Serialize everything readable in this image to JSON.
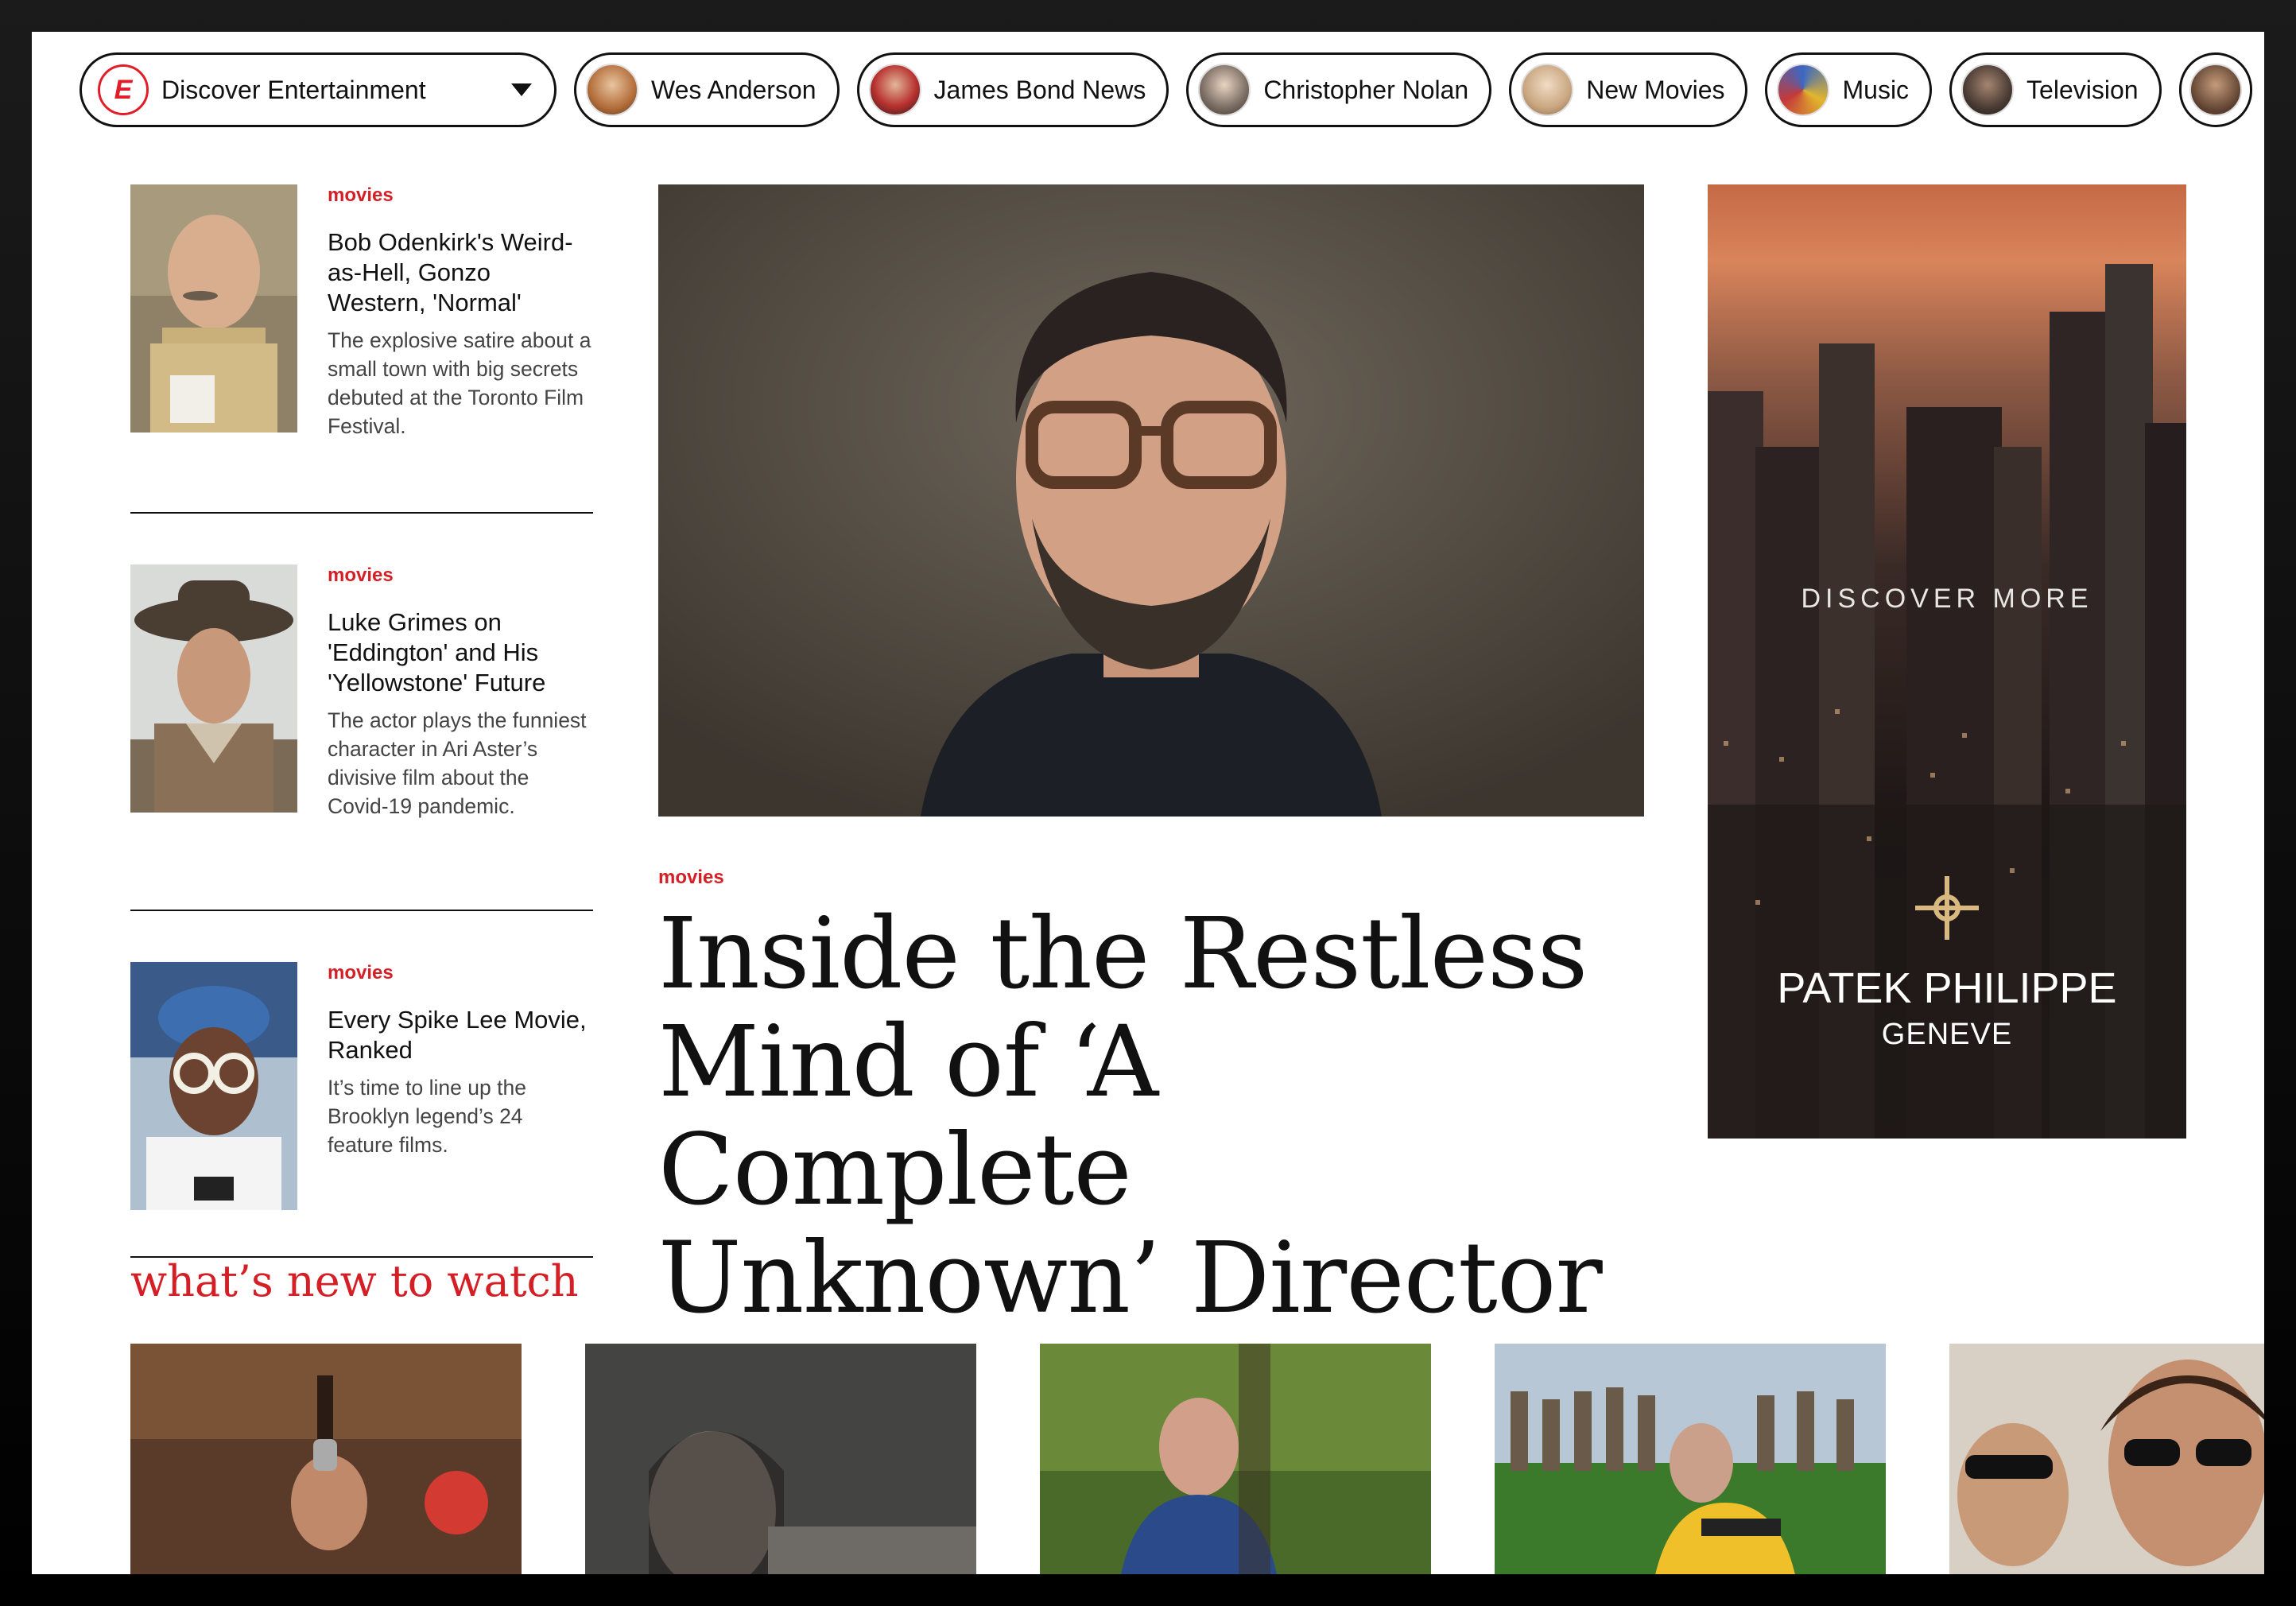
{
  "topbar": {
    "main_label": "Discover Entertainment",
    "logo_glyph": "E",
    "chips": [
      {
        "label": "Wes Anderson",
        "color": "#b36d3a"
      },
      {
        "label": "James Bond News",
        "color": "#b8312f"
      },
      {
        "label": "Christopher Nolan",
        "color": "#7a6c62"
      },
      {
        "label": "New Movies",
        "color": "#c9a680"
      },
      {
        "label": "Music",
        "color": "#3a68c4"
      },
      {
        "label": "Television",
        "color": "#4a3b34"
      }
    ]
  },
  "sidebar": {
    "stories": [
      {
        "category": "movies",
        "title": "Bob Odenkirk's Weird-as-Hell, Gonzo Western, 'Normal'",
        "description": "The  explosive satire about a small town with big secrets debuted at the Toronto Film Festival."
      },
      {
        "category": "movies",
        "title": "Luke Grimes on 'Eddington' and His 'Yellowstone' Future",
        "description": "The actor plays the funniest character in Ari Aster’s divisive film about the Covid-19 pandemic."
      },
      {
        "category": "movies",
        "title": "Every Spike Lee Movie, Ranked",
        "description": "It’s time to line up the Brooklyn legend’s 24 feature films."
      }
    ]
  },
  "feature": {
    "category": "movies",
    "headline": "Inside the Restless Mind of ‘A Complete Unknown’ Director"
  },
  "ad": {
    "cta": "DISCOVER MORE",
    "brand": "PATEK PHILIPPE",
    "city": "GENEVE"
  },
  "whats_new": {
    "title": "what’s new to watch"
  }
}
